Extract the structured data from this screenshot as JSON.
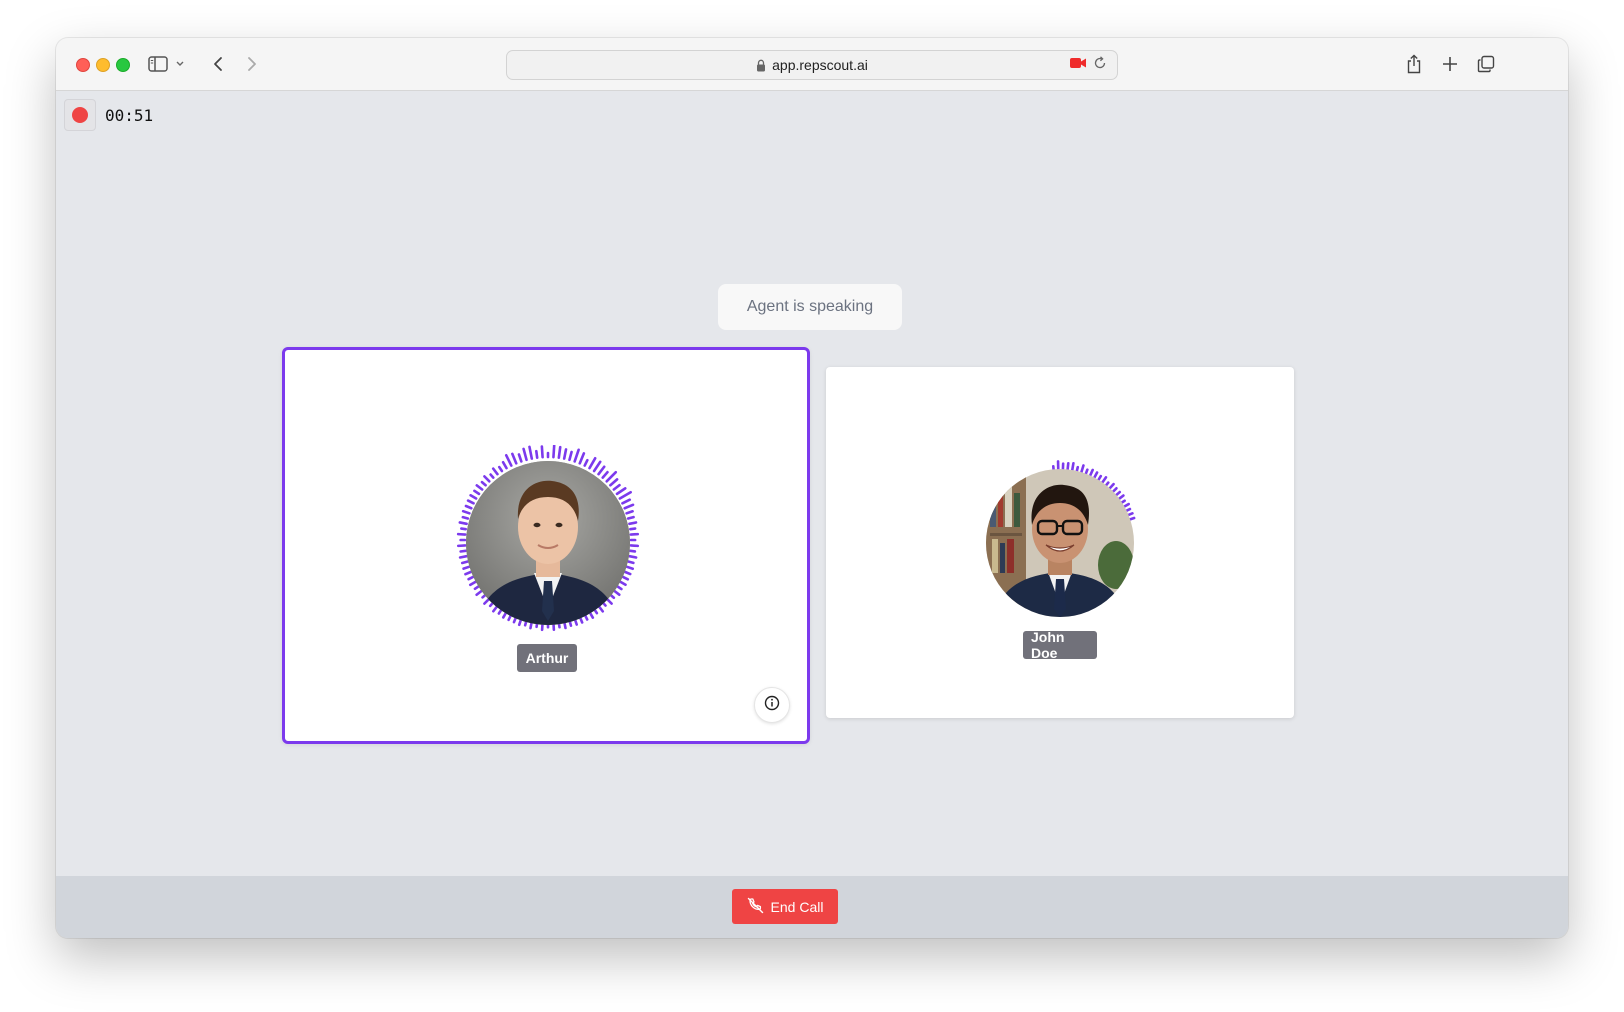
{
  "browser": {
    "url": "app.repscout.ai",
    "icons": [
      "sidebar-icon",
      "chevron-down-icon",
      "back-icon",
      "forward-icon",
      "lock-icon",
      "camera-recording-icon",
      "reload-icon",
      "share-icon",
      "new-tab-icon",
      "tabs-overview-icon"
    ]
  },
  "recording": {
    "time": "00:51",
    "indicator_color": "#ef4444"
  },
  "status": {
    "text": "Agent is speaking"
  },
  "participants": [
    {
      "name": "Arthur",
      "role": "agent",
      "speaking": true
    },
    {
      "name": "John Doe",
      "role": "user",
      "speaking": false
    }
  ],
  "colors": {
    "accent": "#7c3aed",
    "danger": "#ef4444"
  },
  "footer": {
    "end_call_label": "End Call"
  }
}
